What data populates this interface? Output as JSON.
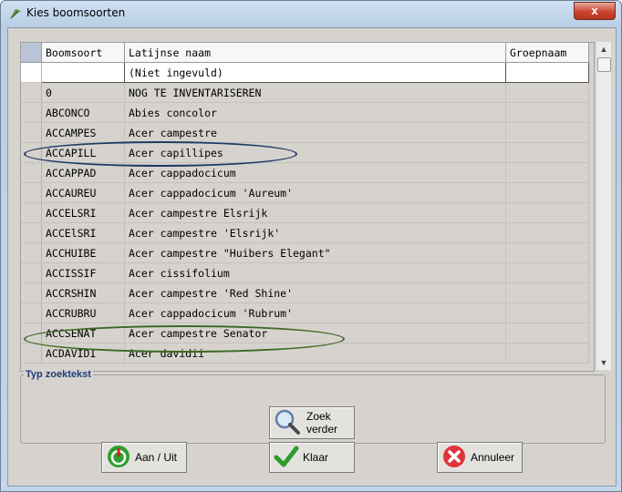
{
  "window": {
    "title": "Kies boomsoorten",
    "close_glyph": "x"
  },
  "grid": {
    "headers": [
      "Boomsoort",
      "Latijnse naam",
      "Groepnaam"
    ],
    "filter_row": {
      "code": "",
      "latin": "(Niet ingevuld)",
      "group": ""
    },
    "rows": [
      {
        "code": "0",
        "latin": "NOG TE INVENTARISEREN",
        "group": ""
      },
      {
        "code": "ABCONCO",
        "latin": "Abies concolor",
        "group": ""
      },
      {
        "code": "ACCAMPES",
        "latin": "Acer campestre",
        "group": ""
      },
      {
        "code": "ACCAPILL",
        "latin": "Acer capillipes",
        "group": ""
      },
      {
        "code": "ACCAPPAD",
        "latin": "Acer cappadocicum",
        "group": ""
      },
      {
        "code": "ACCAUREU",
        "latin": "Acer cappadocicum 'Aureum'",
        "group": ""
      },
      {
        "code": "ACCELSRI",
        "latin": "Acer campestre Elsrijk",
        "group": ""
      },
      {
        "code": "ACCElSRI",
        "latin": "Acer campestre 'Elsrijk'",
        "group": ""
      },
      {
        "code": "ACCHUIBE",
        "latin": "Acer campestre \"Huibers Elegant\"",
        "group": ""
      },
      {
        "code": "ACCISSIF",
        "latin": "Acer cissifolium",
        "group": ""
      },
      {
        "code": "ACCRSHIN",
        "latin": "Acer campestre 'Red Shine'",
        "group": ""
      },
      {
        "code": "ACCRUBRU",
        "latin": "Acer cappadocicum 'Rubrum'",
        "group": ""
      },
      {
        "code": "ACCSENAT",
        "latin": "Acer campestre Senator",
        "group": ""
      },
      {
        "code": "ACDAVIDI",
        "latin": "Acer davidii",
        "group": ""
      }
    ]
  },
  "search": {
    "legend": "Typ zoektekst"
  },
  "buttons": {
    "zoek_line1": "Zoek",
    "zoek_line2": "verder",
    "aan_uit": "Aan / Uit",
    "klaar": "Klaar",
    "annuleer": "Annuleer"
  },
  "colors": {
    "highlight_blue": "#1e3b66",
    "highlight_green": "#3e6a23",
    "legend": "#1f3d7a"
  },
  "icons": {
    "app": "tree-icon",
    "zoek": "magnifier-icon",
    "aan_uit": "power-icon",
    "klaar": "checkmark-icon",
    "annuleer": "cancel-icon"
  }
}
